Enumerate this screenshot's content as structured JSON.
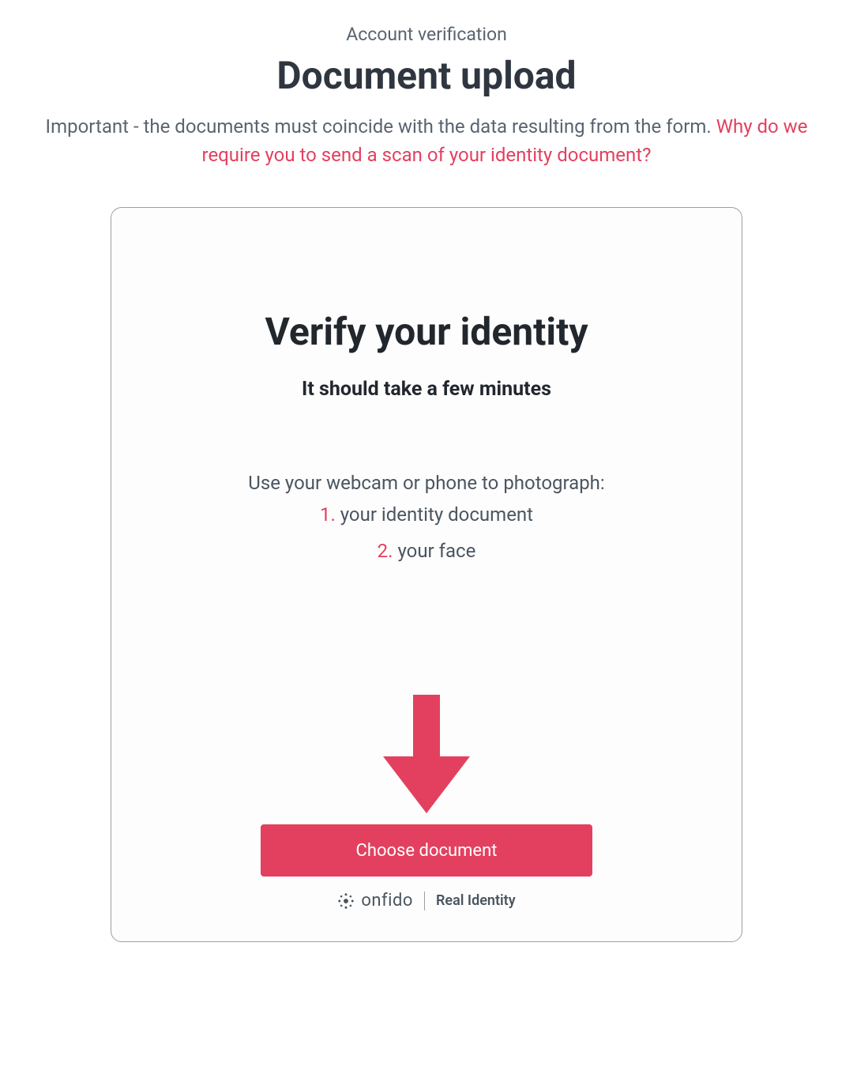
{
  "header": {
    "overline": "Account verification",
    "title": "Document upload",
    "important_text": "Important - the documents must coincide with the data resulting from the form. ",
    "important_link": "Why do we require you to send a scan of your identity document?"
  },
  "card": {
    "title": "Verify your identity",
    "subtitle": "It should take a few minutes",
    "instructions_lead": "Use your webcam or phone to photograph:",
    "steps": [
      {
        "number": "1.",
        "text": " your identity document"
      },
      {
        "number": "2.",
        "text": " your face"
      }
    ],
    "button_label": "Choose document",
    "brand": {
      "name": "onfido",
      "tagline": "Real Identity"
    },
    "colors": {
      "accent": "#e3405f"
    }
  }
}
